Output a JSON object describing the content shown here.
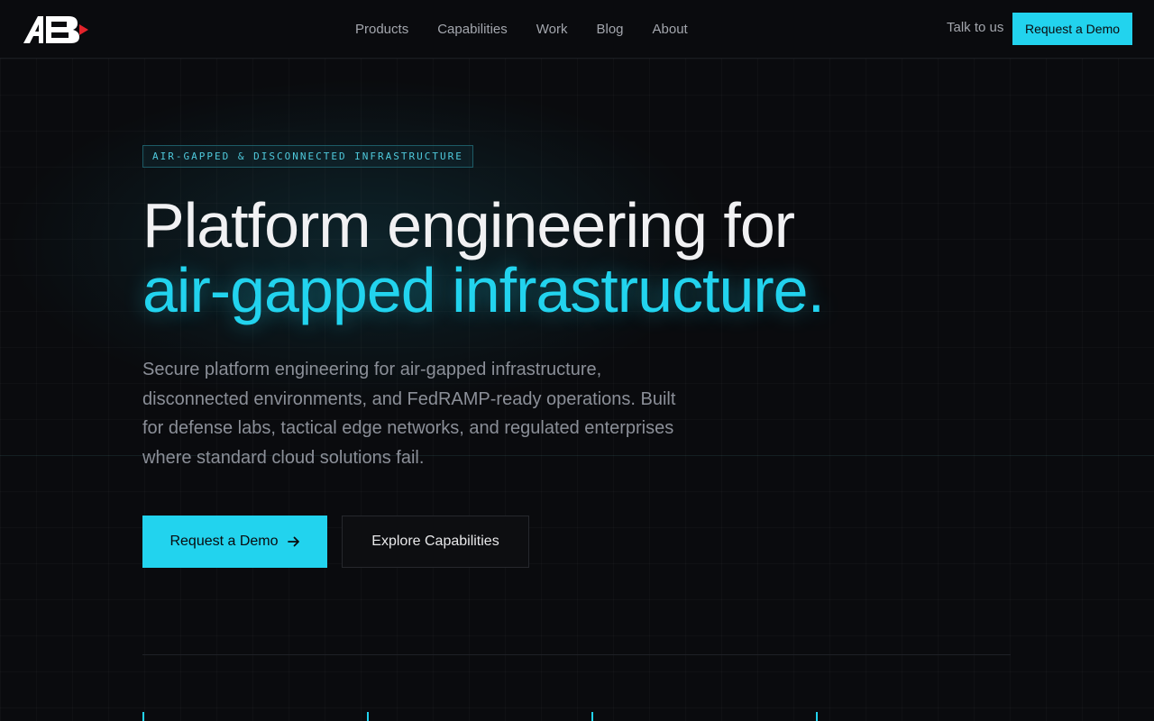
{
  "nav": {
    "logo_text": "AB",
    "links": [
      "Products",
      "Capabilities",
      "Work",
      "Blog",
      "About"
    ],
    "talk": "Talk to us",
    "demo": "Request a Demo"
  },
  "hero": {
    "tag": "AIR-GAPPED & DISCONNECTED INFRASTRUCTURE",
    "title_line1": "Platform engineering for",
    "title_line2": "air-gapped infrastructure.",
    "description": "Secure platform engineering for air-gapped infrastructure, disconnected environments, and FedRAMP-ready operations. Built for defense labs, tactical edge networks, and regulated enterprises where standard cloud solutions fail.",
    "primary_cta": "Request a Demo",
    "secondary_cta": "Explore Capabilities"
  },
  "colors": {
    "accent": "#22d3ee",
    "background": "#0a0b0e",
    "logo_red": "#e3232b"
  }
}
